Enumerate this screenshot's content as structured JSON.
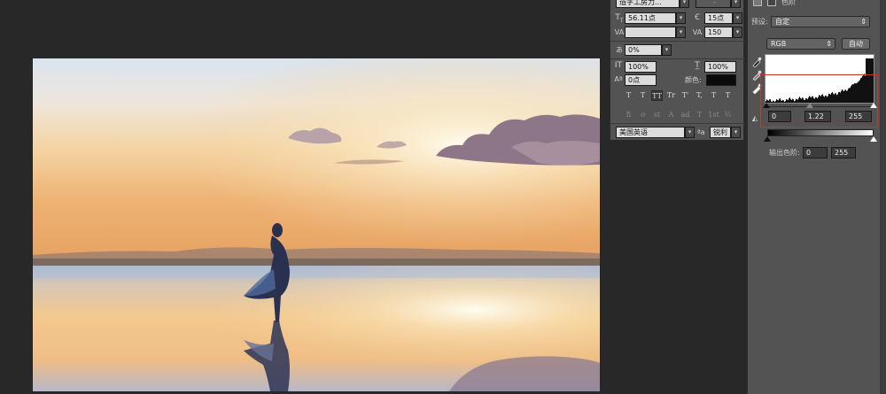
{
  "character": {
    "font_family": "造字工房力...",
    "font_style": "-",
    "font_size": "56.11点",
    "leading": "15点",
    "kerning": "",
    "tracking": "150",
    "scale_pct": "0%",
    "vertical_scale": "100%",
    "horizontal_scale": "100%",
    "baseline_shift": "0点",
    "color_label": "颜色:",
    "color_value": "#0a0a0a",
    "style_buttons": [
      "T",
      "T",
      "TT",
      "Tr",
      "T'",
      "T,",
      "T",
      "T"
    ],
    "opentype_buttons": [
      "fi",
      "ơ",
      "st",
      "A",
      "ad",
      "T",
      "1st",
      "½"
    ],
    "language": "美国英语",
    "aa_icon_label": "ªa",
    "antialias": "锐利"
  },
  "levels": {
    "panel_title": "色阶",
    "preset_label": "预设:",
    "preset_value": "自定",
    "channel": "RGB",
    "auto_button": "自动",
    "input_black": "0",
    "input_gamma": "1.22",
    "input_white": "255",
    "output_label": "输出色阶:",
    "output_black": "0",
    "output_white": "255",
    "histogram_highlight_color": "#c0392b"
  },
  "icons": [
    "image-icon",
    "adjustment-icon",
    "eyedropper-black-icon",
    "eyedropper-gray-icon",
    "eyedropper-white-icon",
    "clipping-icon",
    "tracking-icon",
    "kerning-icon",
    "leading-icon",
    "font-size-icon",
    "vertical-scale-icon",
    "horizontal-scale-icon",
    "baseline-shift-icon"
  ]
}
